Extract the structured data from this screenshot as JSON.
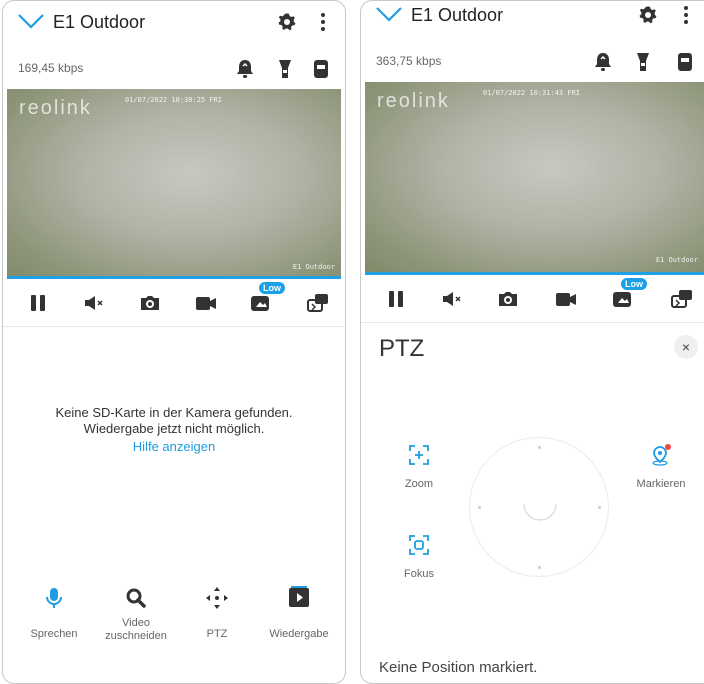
{
  "colors": {
    "accent": "#1e9de3",
    "video_bar": "#22a0e6",
    "icon_dark": "#333333",
    "red_dot": "#f04747"
  },
  "left": {
    "title": "E1 Outdoor",
    "bitrate": "169,45 kbps",
    "video": {
      "logo": "reolink",
      "osd_time": "01/07/2022 10:30:25 FRI",
      "cam_name": "E1 Outdoor"
    },
    "badge": "Low",
    "message_line1": "Keine SD-Karte in der Kamera gefunden.",
    "message_line2": "Wiedergabe jetzt nicht möglich.",
    "help_link": "Hilfe anzeigen",
    "bottom": {
      "speak": "Sprechen",
      "crop": "Video zuschneiden",
      "ptz": "PTZ",
      "playback": "Wiedergabe"
    }
  },
  "right": {
    "title": "E1 Outdoor",
    "bitrate": "363,75 kbps",
    "video": {
      "logo": "reolink",
      "osd_time": "01/07/2022 10:31:43 FRI",
      "cam_name": "E1 Outdoor"
    },
    "badge": "Low",
    "ptz_title": "PTZ",
    "close": "×",
    "zoom": "Zoom",
    "focus": "Fokus",
    "mark": "Markieren",
    "status": "Keine Position markiert."
  },
  "icons": [
    "chevron-down-icon",
    "gear-icon",
    "more-icon",
    "bell-icon",
    "spotlight-icon",
    "device-icon",
    "pause-icon",
    "mute-icon",
    "camera-icon",
    "record-icon",
    "quality-icon",
    "snapshot-icon",
    "mic-icon",
    "crop-search-icon",
    "ptz-arrows-icon",
    "playback-icon",
    "zoom-icon",
    "focus-icon",
    "mark-pin-icon"
  ]
}
